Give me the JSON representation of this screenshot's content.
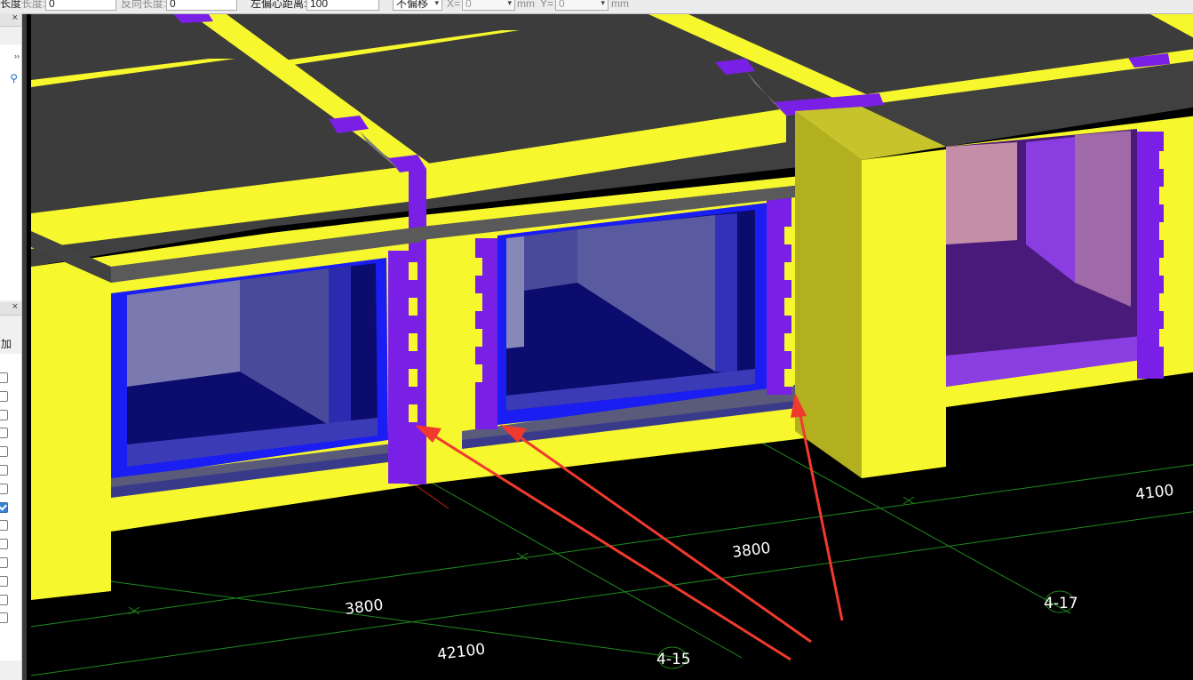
{
  "toolbar": {
    "length_label": "长度",
    "length2_label": "长度:",
    "length_value": "0",
    "reverse_length_label": "反向长度:",
    "reverse_length_value": "0",
    "left_offset_label": "左偏心距离:",
    "left_offset_value": "100",
    "offset_mode": "不偏移",
    "x_label": "X=",
    "x_value": "0",
    "y_label": "Y=",
    "y_value": "0",
    "unit_mm": "mm"
  },
  "left_panel": {
    "close_symbol": "×",
    "expand_symbol": "››",
    "add_label": "加",
    "checkboxes": [
      false,
      false,
      false,
      false,
      false,
      false,
      false,
      true,
      false,
      false,
      false,
      false,
      false,
      false
    ]
  },
  "viewport": {
    "dimensions": [
      "3800",
      "3800",
      "4100",
      "42100"
    ],
    "axis_tags": [
      "4-15",
      "4-17"
    ]
  },
  "colors": {
    "wall": "#f7f72e",
    "wall_shade": "#b2b01f",
    "column": "#7a1fe6",
    "slab": "#3b3b3b",
    "window_frame": "#1a1ef2",
    "arrow": "#f03a2e",
    "grid": "#1f8a1f"
  }
}
